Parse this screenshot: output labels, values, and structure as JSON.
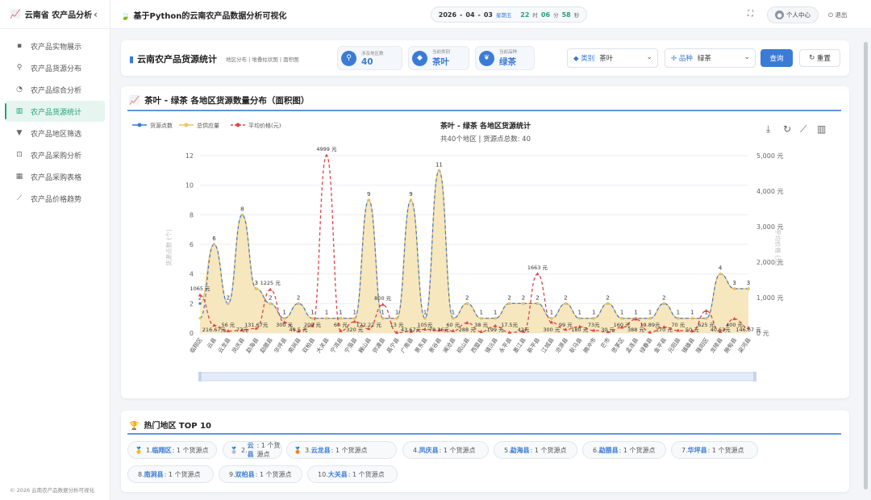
{
  "sidebar": {
    "title": "云南省 农产品分析",
    "items": [
      {
        "icon": "box-icon",
        "label": "农产品实物展示"
      },
      {
        "icon": "pin-icon",
        "label": "农产品货源分布"
      },
      {
        "icon": "pie-icon",
        "label": "农产品综合分析"
      },
      {
        "icon": "chart-icon",
        "label": "农产品货源统计"
      },
      {
        "icon": "filter-icon",
        "label": "农产品地区筛选"
      },
      {
        "icon": "cart-icon",
        "label": "农产品采购分析"
      },
      {
        "icon": "table-icon",
        "label": "农产品采购表格"
      },
      {
        "icon": "trend-icon",
        "label": "农产品价格趋势"
      }
    ],
    "active_index": 3,
    "footer": "© 2026 云南农产品数据分析可视化"
  },
  "header": {
    "title": "基于Python的云南农产品数据分析可视化",
    "clock": {
      "year": "2026",
      "month": "04",
      "day": "03",
      "weekday": "星期五",
      "hour": "22",
      "min": "06",
      "sec": "58",
      "u_h": "时",
      "u_m": "分",
      "u_s": "秒"
    },
    "user": "个人中心",
    "logout": "退出"
  },
  "panel": {
    "title": "云南农产品货源统计",
    "subtitle": "地区分布 | 堆叠柱状图 | 面积图",
    "stats": [
      {
        "label": "涉及地区数",
        "value": "40",
        "icon": "pin-icon"
      },
      {
        "label": "当前类别",
        "value": "茶叶",
        "icon": "tag-icon"
      },
      {
        "label": "当前品种",
        "value": "绿茶",
        "icon": "leaf-icon"
      }
    ],
    "category_label": "类别",
    "category_value": "茶叶",
    "variety_label": "品种",
    "variety_value": "绿茶",
    "query_btn": "查询",
    "reset_btn": "重置"
  },
  "chart_card": {
    "header": "茶叶 - 绿茶 各地区货源数量分布（面积图）"
  },
  "chart_data": {
    "type": "area",
    "title": "茶叶 - 绿茶 各地区货源统计",
    "subtitle": "共40个地区 | 货源点总数: 40",
    "legend": [
      "货源点数",
      "总供应量",
      "平均价格(元)"
    ],
    "ylabel": "货源点数 (个)",
    "y2label": "平均价格 (元)",
    "ylim": [
      0,
      12
    ],
    "y2lim": [
      0,
      5000
    ],
    "y_ticks": [
      "0",
      "2",
      "4",
      "6",
      "8",
      "10",
      "12"
    ],
    "y2_ticks": [
      "0 元",
      "1,000 元",
      "2,000 元",
      "3,000 元",
      "4,000 元",
      "5,000 元"
    ],
    "categories": [
      "临翔区",
      "云县",
      "云龙县",
      "凤庆县",
      "勐海县",
      "勐腊县",
      "华坪县",
      "南涧县",
      "双柏县",
      "大关县",
      "宁洱县",
      "宁蒗县",
      "巍山县",
      "弥渡县",
      "昌宁县",
      "广南县",
      "景东县",
      "景谷县",
      "澜沧县",
      "砚山县",
      "西盟县",
      "镇沅县",
      "永平县",
      "墨江县",
      "新平县",
      "江城县",
      "沧源县",
      "耿马县",
      "腾冲市",
      "芒市",
      "思茅区",
      "孟连县",
      "绿春县",
      "金平县",
      "元阳县",
      "镇雄县",
      "隆阳区",
      "龙陵县",
      "施甸县",
      "梁河县"
    ],
    "count": [
      2,
      6,
      2,
      8,
      3,
      2,
      1,
      2,
      1,
      1,
      1,
      1,
      9,
      1,
      1,
      9,
      1,
      11,
      1,
      2,
      1,
      1,
      2,
      2,
      2,
      1,
      2,
      1,
      1,
      2,
      1,
      1,
      1,
      2,
      1,
      1,
      1,
      4,
      3,
      3
    ],
    "supply": [
      1,
      6,
      2,
      8,
      3,
      2,
      1,
      2,
      1,
      1,
      1,
      1,
      9,
      1,
      1,
      9,
      1,
      11,
      1,
      2,
      1,
      1,
      2,
      2,
      2,
      1,
      2,
      1,
      1,
      2,
      1,
      1,
      1,
      2,
      1,
      1,
      1,
      4,
      3,
      3
    ],
    "price": [
      1065,
      216.67,
      56,
      77,
      131.67,
      1225,
      300,
      49.5,
      200,
      4999,
      60,
      320,
      122.22,
      800,
      13,
      43.67,
      105,
      78.36,
      60,
      288,
      38,
      199,
      17.5,
      42,
      1663,
      300,
      99,
      180,
      73,
      30,
      160,
      388,
      19.89,
      170,
      70,
      50,
      625,
      40.63,
      400,
      146.67
    ],
    "price_labels": [
      "1065 元",
      "216.67元",
      "56 元",
      "77元",
      "131.67元",
      "1225 元",
      "300 元",
      "49.5 元",
      "200 元",
      "4999 元",
      "60 元",
      "320 元",
      "122.22 元",
      "800 元",
      "13 元",
      "43.67元",
      "105元",
      "78.36元",
      "60 元",
      "288 元",
      "38 元",
      "199 元",
      "17.5元",
      "42元",
      "1663 元",
      "300 元",
      "99 元",
      "180 元",
      "73元",
      "30 元",
      "160 元",
      "388 元",
      "19.89元",
      "170 元",
      "70 元",
      "50 元",
      "625 元",
      "40.63元",
      "400 元",
      "146.67 元"
    ]
  },
  "hot": {
    "title": "热门地区 TOP 10",
    "items": [
      {
        "rank": "1.",
        "name": "临翔区",
        "text": ": 1 个货源点",
        "medal": "🥇"
      },
      {
        "rank": "2.",
        "name": "云县",
        "text": ": 1 个货源点",
        "medal": "🥈"
      },
      {
        "rank": "3.",
        "name": "云龙县",
        "text": ": 1 个货源点",
        "medal": "🥉"
      },
      {
        "rank": "4.",
        "name": "凤庆县",
        "text": ": 1 个货源点",
        "medal": ""
      },
      {
        "rank": "5.",
        "name": "勐海县",
        "text": ": 1 个货源点",
        "medal": ""
      },
      {
        "rank": "6.",
        "name": "勐腊县",
        "text": ": 1 个货源点",
        "medal": ""
      },
      {
        "rank": "7.",
        "name": "华坪县",
        "text": ": 1 个货源点",
        "medal": ""
      },
      {
        "rank": "8.",
        "name": "南涧县",
        "text": ": 1 个货源点",
        "medal": ""
      },
      {
        "rank": "9.",
        "name": "双柏县",
        "text": ": 1 个货源点",
        "medal": ""
      },
      {
        "rank": "10.",
        "name": "大关县",
        "text": ": 1 个货源点",
        "medal": ""
      }
    ]
  }
}
